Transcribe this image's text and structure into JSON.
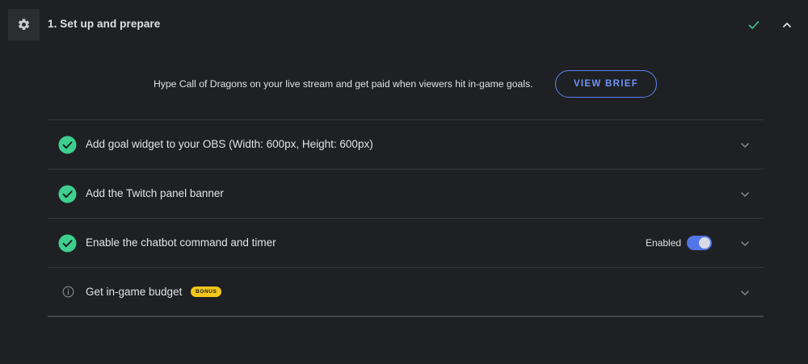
{
  "header": {
    "title": "1. Set up and prepare",
    "gear_icon": "gear-icon",
    "status_icon": "check-icon",
    "collapse_icon": "chevron-up-icon"
  },
  "brief": {
    "text": "Hype Call of Dragons on your live stream and get paid when viewers hit in-game goals.",
    "button_label": "VIEW BRIEF"
  },
  "steps": [
    {
      "label": "Add goal widget to your OBS (Width: 600px, Height: 600px)",
      "status": "completed",
      "icon": "check-circle-icon"
    },
    {
      "label": "Add the Twitch panel banner",
      "status": "completed",
      "icon": "check-circle-icon"
    },
    {
      "label": "Enable the chatbot command and timer",
      "status": "completed",
      "icon": "check-circle-icon",
      "toggle_label": "Enabled",
      "toggle_on": true
    },
    {
      "label": "Get in-game budget",
      "status": "pending",
      "icon": "info-icon",
      "badge": "BONUS"
    }
  ],
  "colors": {
    "background": "#1f2023",
    "accent_blue": "#5b82f0",
    "success_green": "#3ecf8e",
    "badge_yellow": "#f2c61c"
  }
}
